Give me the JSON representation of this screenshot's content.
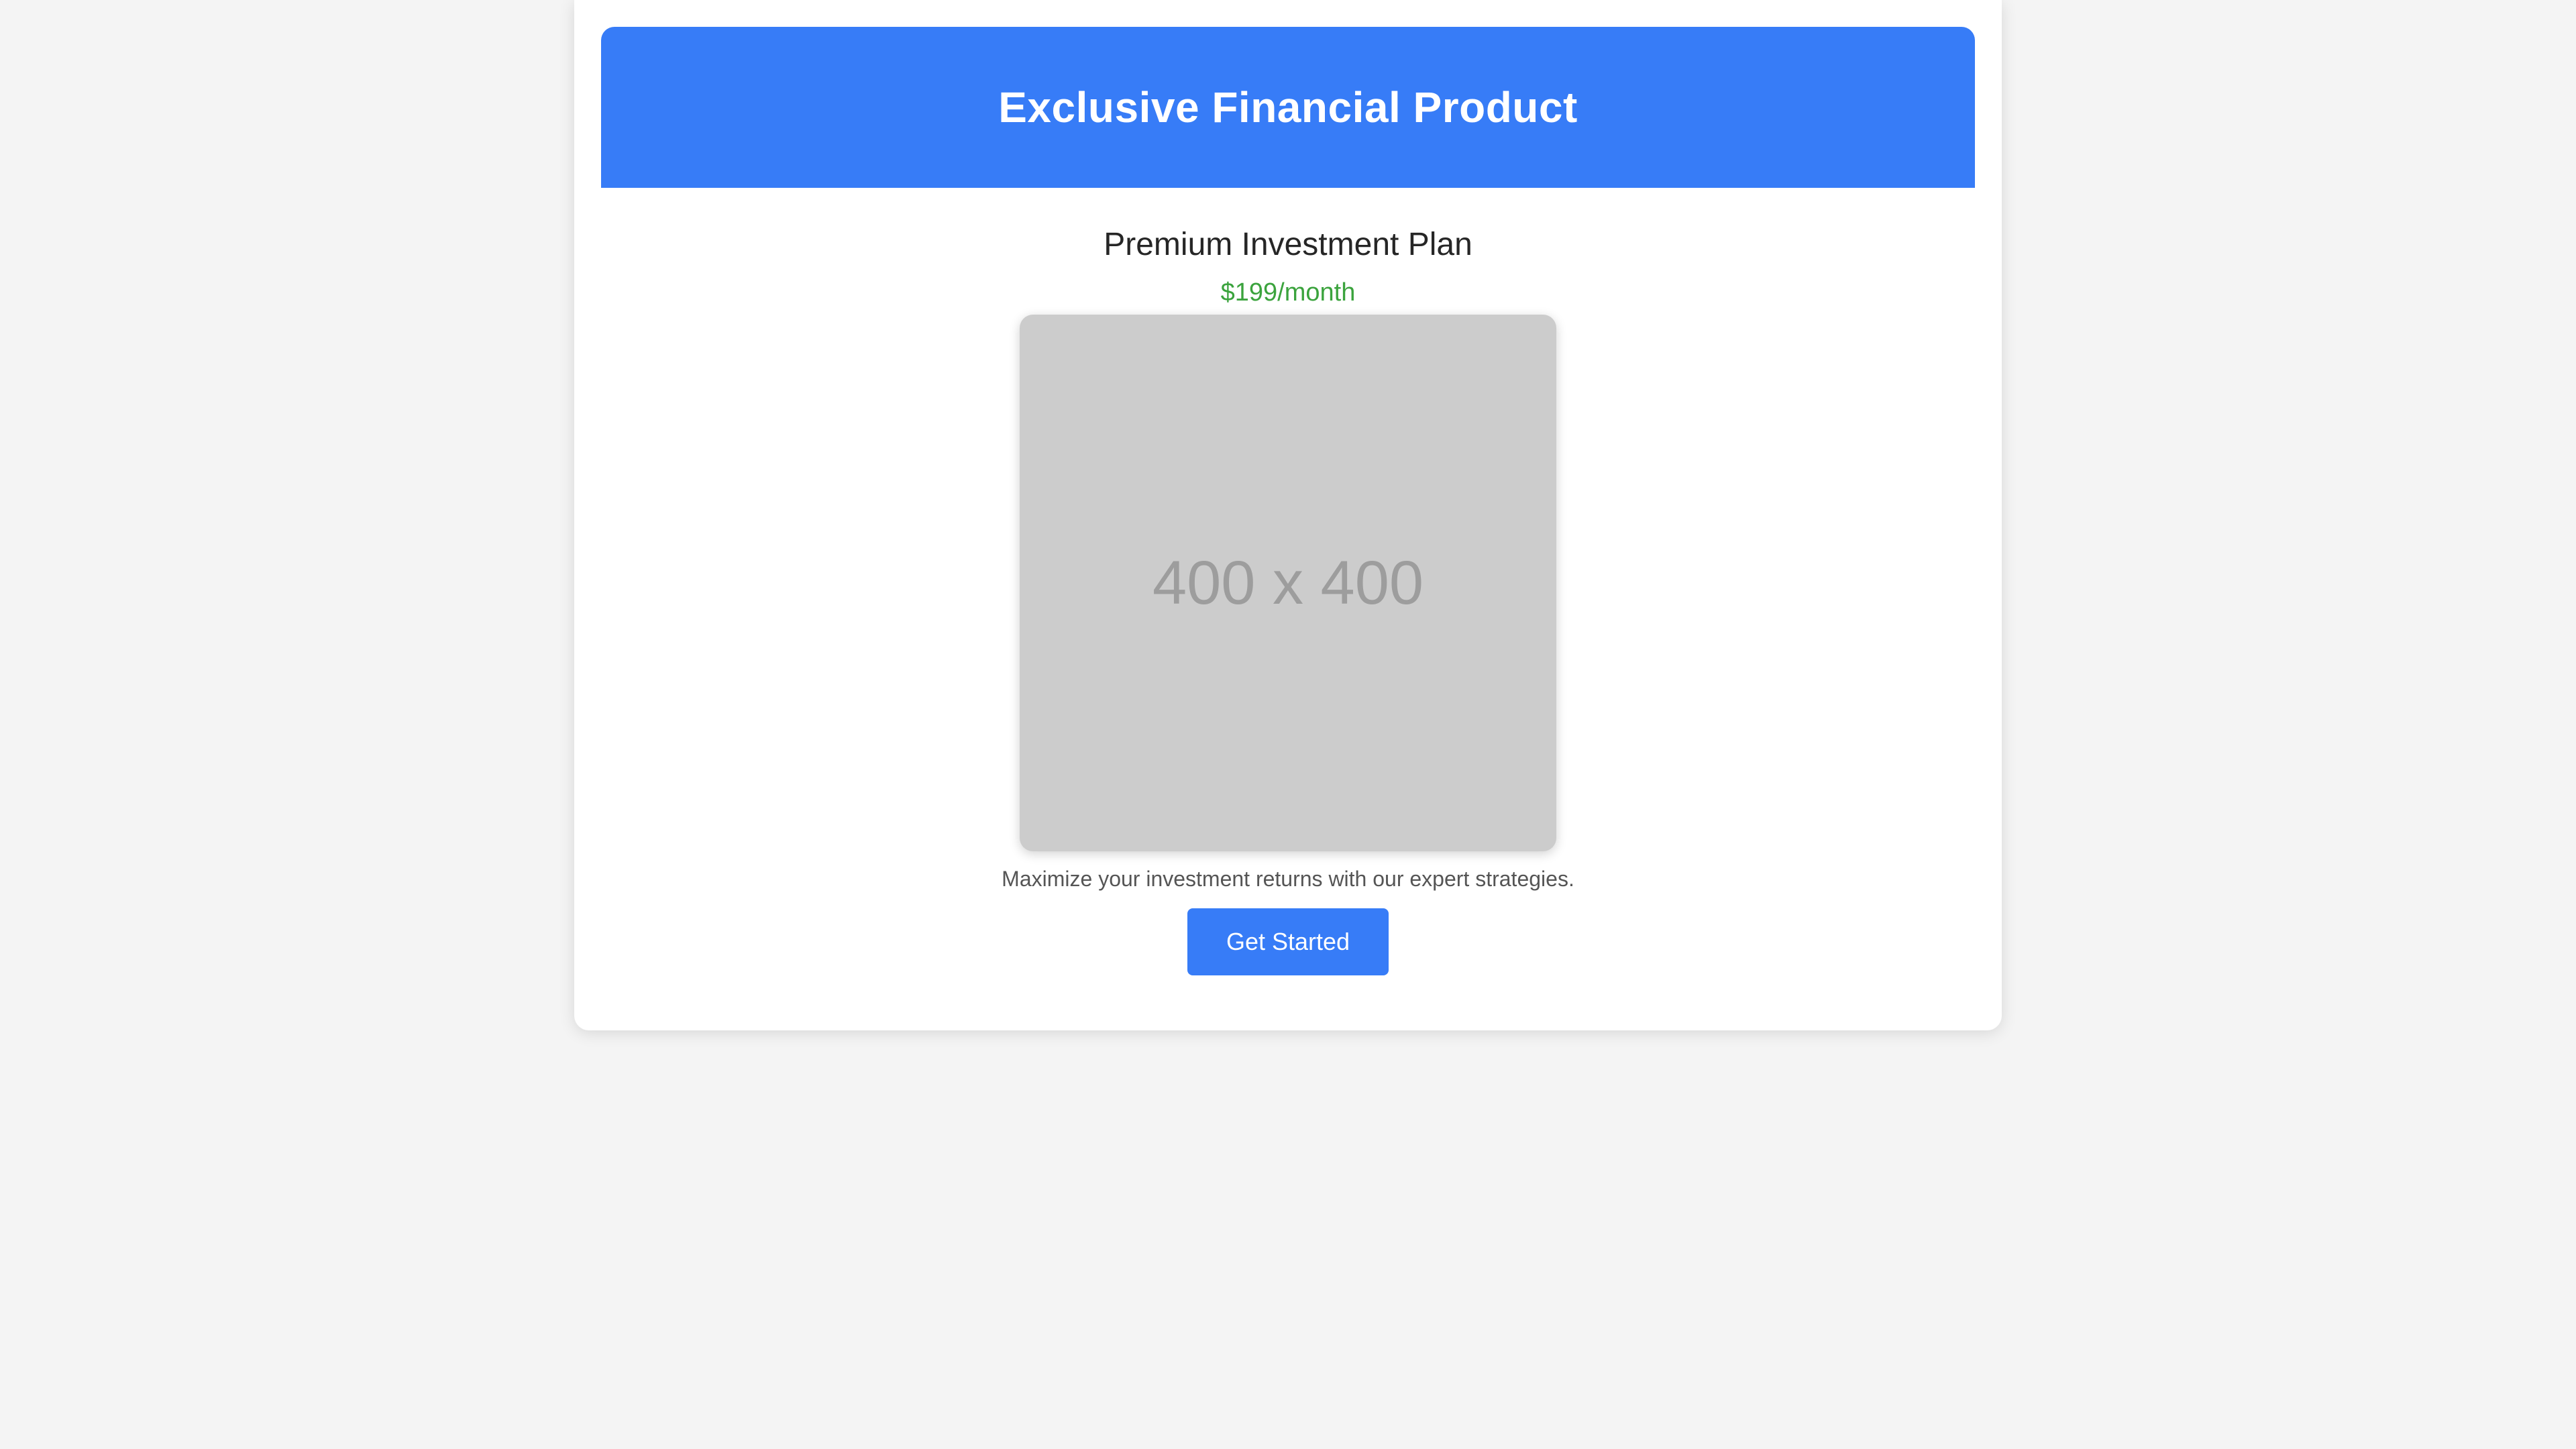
{
  "header": {
    "title": "Exclusive Financial Product"
  },
  "product": {
    "name": "Premium Investment Plan",
    "price": "$199/month",
    "image_placeholder": "400 x 400",
    "description": "Maximize your investment returns with our expert strategies.",
    "cta_label": "Get Started"
  },
  "colors": {
    "accent": "#377cf7",
    "price": "#3ba33d",
    "background": "#f4f4f4",
    "placeholder": "#cccccc"
  }
}
